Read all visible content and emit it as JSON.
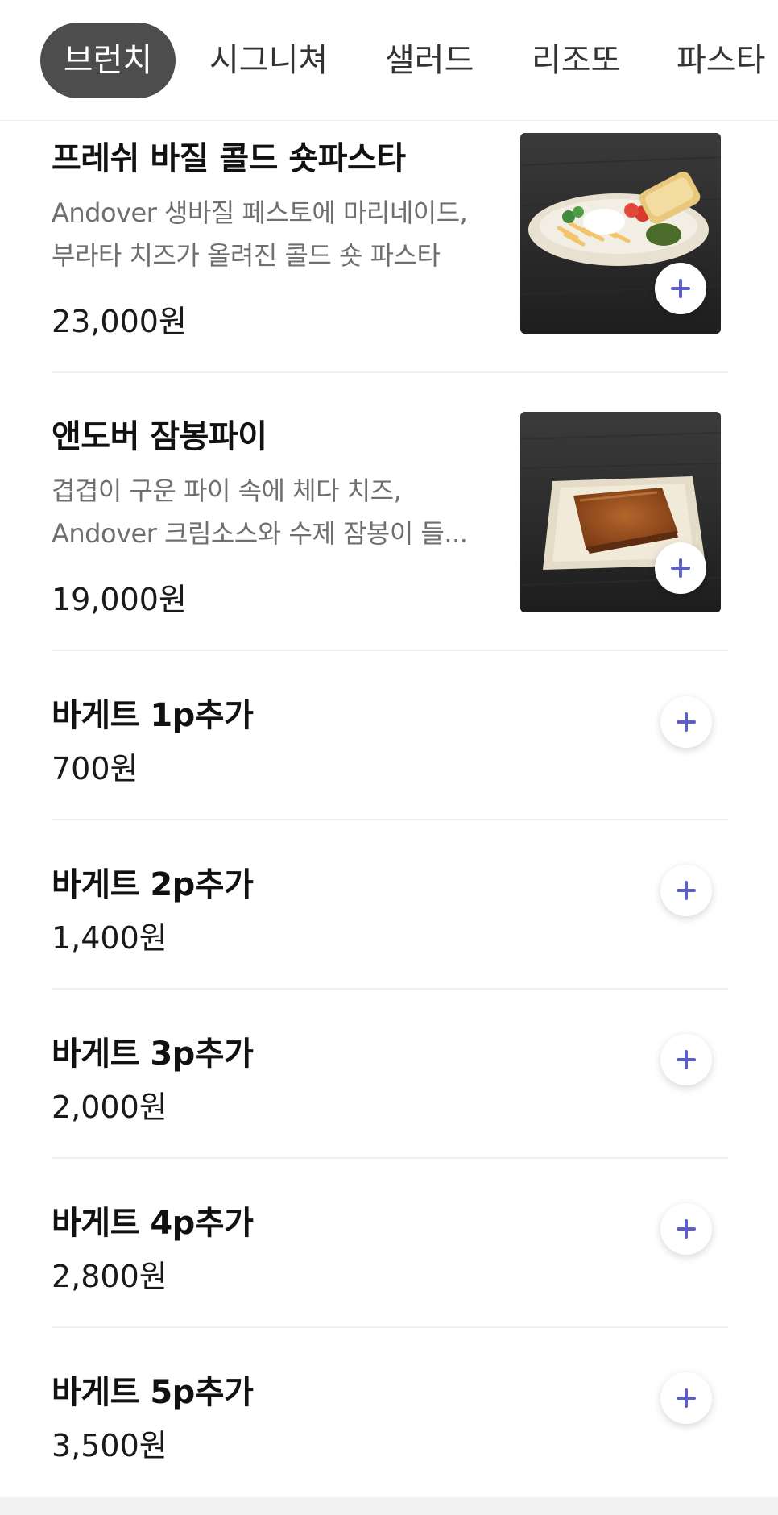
{
  "tabs": [
    {
      "label": "브런치",
      "active": true
    },
    {
      "label": "시그니쳐",
      "active": false
    },
    {
      "label": "샐러드",
      "active": false
    },
    {
      "label": "리조또",
      "active": false
    },
    {
      "label": "파스타",
      "active": false
    }
  ],
  "menu_items": [
    {
      "name": "프레쉬 바질 콜드 숏파스타",
      "description_lines": [
        "Andover 생바질 페스토에 마리네이드,",
        "부라타 치즈가 올려진 콜드 숏 파스타"
      ],
      "price": "23,000원",
      "image": "cold-short-pasta-photo"
    },
    {
      "name": "앤도버 잠봉파이",
      "description_lines": [
        "겹겹이 구운 파이 속에 체다 치즈,",
        "Andover 크림소스와 수제 잠봉이 들..."
      ],
      "price": "19,000원",
      "image": "jambon-pie-photo"
    },
    {
      "name": "바게트 1p추가",
      "price": "700원"
    },
    {
      "name": "바게트 2p추가",
      "price": "1,400원"
    },
    {
      "name": "바게트 3p추가",
      "price": "2,000원"
    },
    {
      "name": "바게트 4p추가",
      "price": "2,800원"
    },
    {
      "name": "바게트 5p추가",
      "price": "3,500원"
    }
  ],
  "icons": {
    "add": "plus-icon"
  },
  "colors": {
    "active_tab_bg": "#4d4d4d",
    "accent_plus": "#5b5fc7",
    "divider": "#f0f0f0"
  }
}
